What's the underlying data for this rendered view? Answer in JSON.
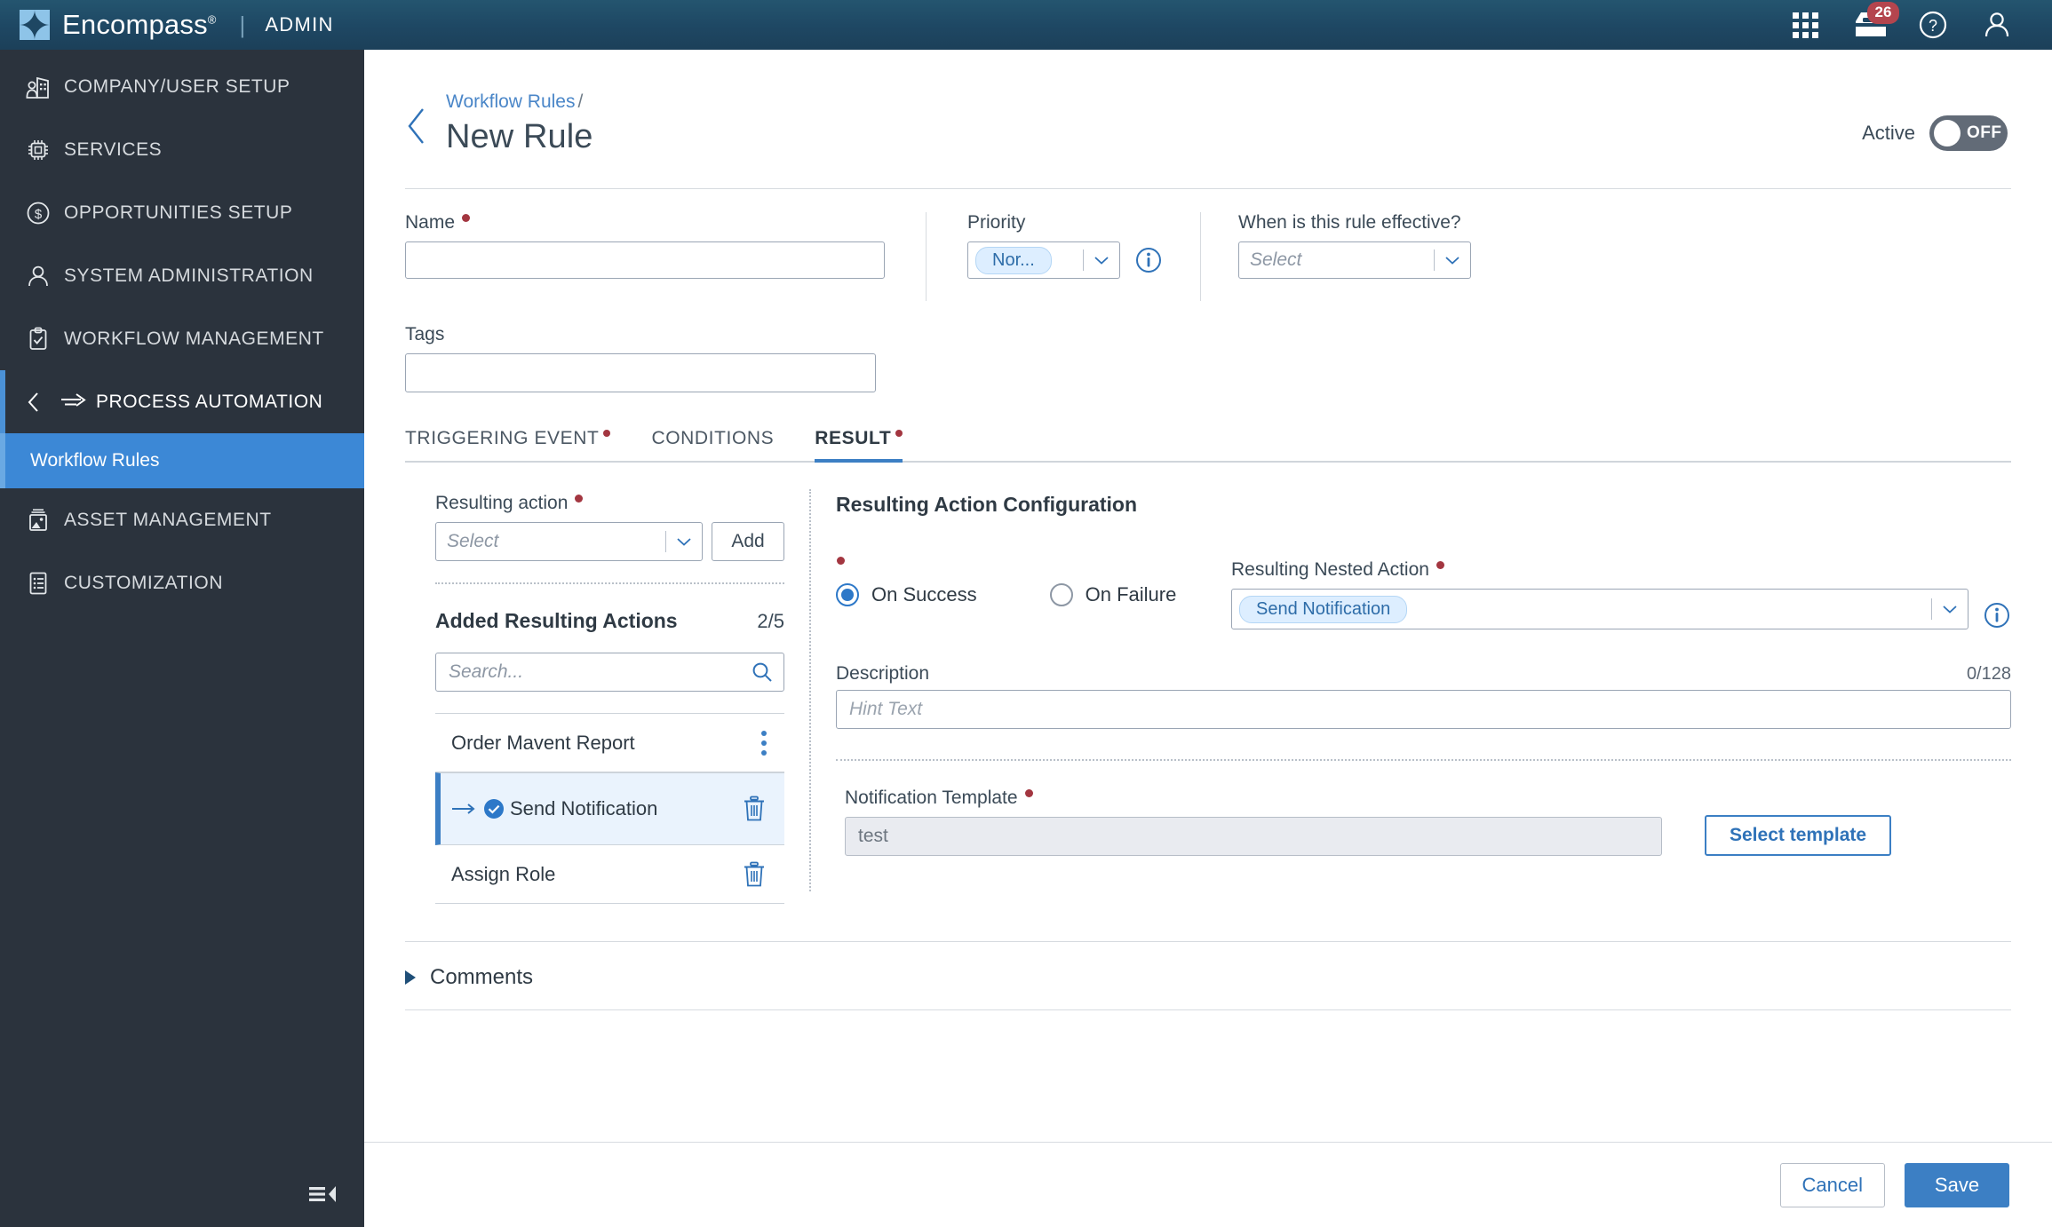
{
  "topbar": {
    "brand_name": "Encompass",
    "brand_reg": "®",
    "divider": "|",
    "section": "ADMIN",
    "icons": {
      "apps": "apps-grid-icon",
      "inbox": "inbox-icon",
      "help": "help-circle-icon",
      "account": "user-account-icon"
    },
    "inbox_badge": "26",
    "accent": "#1e4763"
  },
  "sidebar": {
    "items": [
      {
        "label": "COMPANY/USER SETUP",
        "icon": "company-building-icon"
      },
      {
        "label": "SERVICES",
        "icon": "chip-icon"
      },
      {
        "label": "OPPORTUNITIES SETUP",
        "icon": "dollar-circle-icon"
      },
      {
        "label": "SYSTEM ADMINISTRATION",
        "icon": "person-icon"
      },
      {
        "label": "WORKFLOW MANAGEMENT",
        "icon": "clipboard-check-icon"
      }
    ],
    "expanded_group": {
      "label": "PROCESS AUTOMATION",
      "icon": "process-arrow-icon",
      "back_icon": "chevron-left-icon"
    },
    "active_child": "Workflow Rules",
    "items_after": [
      {
        "label": "ASSET MANAGEMENT",
        "icon": "image-stack-icon"
      },
      {
        "label": "CUSTOMIZATION",
        "icon": "list-document-icon"
      }
    ],
    "collapse_icon": "collapse-panel-icon",
    "bg": "#2b333d",
    "active_bg": "#3c88d6"
  },
  "header": {
    "back_icon": "back-chevron-icon",
    "breadcrumb_link": "Workflow Rules",
    "breadcrumb_separator": "/",
    "title": "New Rule",
    "active_label": "Active",
    "toggle_state": "OFF"
  },
  "form": {
    "name": {
      "label": "Name",
      "required": true,
      "value": "",
      "placeholder": ""
    },
    "priority": {
      "label": "Priority",
      "required": false,
      "value": "Nor...",
      "info_icon": "info-circle-icon"
    },
    "effective": {
      "label": "When is this rule effective?",
      "required": false,
      "placeholder": "Select",
      "value": ""
    },
    "tags": {
      "label": "Tags",
      "value": "",
      "placeholder": ""
    }
  },
  "tabs": [
    {
      "label": "TRIGGERING EVENT",
      "required": true,
      "active": false
    },
    {
      "label": "CONDITIONS",
      "required": false,
      "active": false
    },
    {
      "label": "RESULT",
      "required": true,
      "active": true
    }
  ],
  "result": {
    "resulting_action": {
      "label": "Resulting action",
      "required": true,
      "placeholder": "Select",
      "add_button": "Add"
    },
    "added": {
      "title": "Added Resulting Actions",
      "count": "2/5",
      "search_placeholder": "Search...",
      "search_icon": "search-icon",
      "items": [
        {
          "label": "Order Mavent Report",
          "selected": false,
          "trailing_icon": "kebab-menu-icon",
          "nested": false
        },
        {
          "label": "Send Notification",
          "selected": true,
          "trailing_icon": "trash-icon",
          "nested": true,
          "status_icon": "check-circle-icon",
          "nest_icon": "arrow-right-icon"
        },
        {
          "label": "Assign Role",
          "selected": false,
          "trailing_icon": "trash-icon",
          "nested": false
        }
      ]
    },
    "config": {
      "title": "Resulting Action Configuration",
      "outcome_required": true,
      "radios": [
        {
          "label": "On Success",
          "checked": true
        },
        {
          "label": "On Failure",
          "checked": false
        }
      ],
      "nested_action": {
        "label": "Resulting Nested Action",
        "required": true,
        "value": "Send Notification",
        "info_icon": "info-circle-icon"
      },
      "description": {
        "label": "Description",
        "counter": "0/128",
        "placeholder": "Hint Text",
        "value": ""
      },
      "notification_template": {
        "label": "Notification Template",
        "required": true,
        "value": "test",
        "button": "Select template"
      }
    }
  },
  "comments": {
    "label": "Comments",
    "expand_icon": "triangle-right-icon"
  },
  "footer": {
    "cancel": "Cancel",
    "save": "Save"
  }
}
